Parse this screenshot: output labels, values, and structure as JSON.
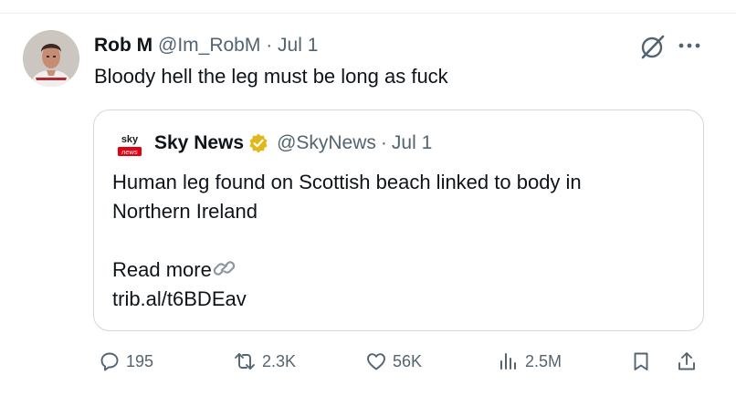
{
  "tweet": {
    "author_name": "Rob M",
    "author_handle": "@Im_RobM",
    "separator": "·",
    "date": "Jul 1",
    "text": "Bloody hell the leg must be long as fuck"
  },
  "quoted_tweet": {
    "avatar_logo_text": "sky news",
    "author_name": "Sky News",
    "verified_icon": "gold-verified-badge",
    "author_handle": "@SkyNews",
    "separator": "·",
    "date": "Jul 1",
    "text_line_1": "Human leg found on Scottish beach linked to body in",
    "text_line_2": "Northern Ireland",
    "read_more": "Read more",
    "link_icon": "link-chain-icon",
    "url": "trib.al/t6BDEav"
  },
  "actions": {
    "replies": "195",
    "retweets": "2.3K",
    "likes": "56K",
    "views": "2.5M"
  },
  "icons": {
    "grok": "grok-slash-circle-icon",
    "more": "more-horizontal-icon",
    "reply": "reply-icon",
    "retweet": "retweet-icon",
    "like": "heart-icon",
    "views": "views-bars-icon",
    "bookmark": "bookmark-icon",
    "share": "share-icon"
  },
  "colors": {
    "text": "#0f1419",
    "secondary": "#536471",
    "border": "#cfd9de",
    "verified_gold": "#e2b719",
    "sky_red": "#e10014"
  }
}
